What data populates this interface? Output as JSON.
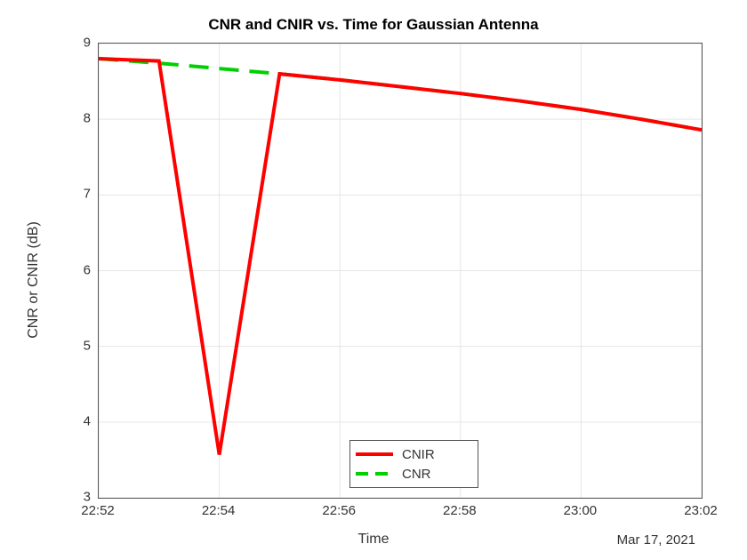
{
  "chart_data": {
    "type": "line",
    "title": "CNR and CNIR vs. Time for Gaussian Antenna",
    "xlabel": "Time",
    "ylabel": "CNR or CNIR (dB)",
    "date_annotation": "Mar 17, 2021",
    "x_categories": [
      "22:52",
      "22:53",
      "22:54",
      "22:55",
      "22:56",
      "22:57",
      "22:58",
      "22:59",
      "23:00",
      "23:01",
      "23:02"
    ],
    "x_ticks": [
      "22:52",
      "22:54",
      "22:56",
      "22:58",
      "23:00",
      "23:02"
    ],
    "y_ticks": [
      3,
      4,
      5,
      6,
      7,
      8,
      9
    ],
    "ylim": [
      3,
      9
    ],
    "series": [
      {
        "name": "CNIR",
        "style": "solid",
        "color": "#ff0000",
        "values": [
          8.8,
          8.77,
          3.57,
          8.6,
          8.52,
          8.43,
          8.34,
          8.24,
          8.13,
          8.0,
          7.86
        ]
      },
      {
        "name": "CNR",
        "style": "dashed",
        "color": "#00d000",
        "values": [
          8.8,
          8.74,
          8.67,
          8.6,
          8.52,
          8.43,
          8.34,
          8.24,
          8.13,
          8.0,
          7.86
        ]
      }
    ],
    "legend": {
      "entries": [
        "CNIR",
        "CNR"
      ],
      "position": "south"
    }
  }
}
